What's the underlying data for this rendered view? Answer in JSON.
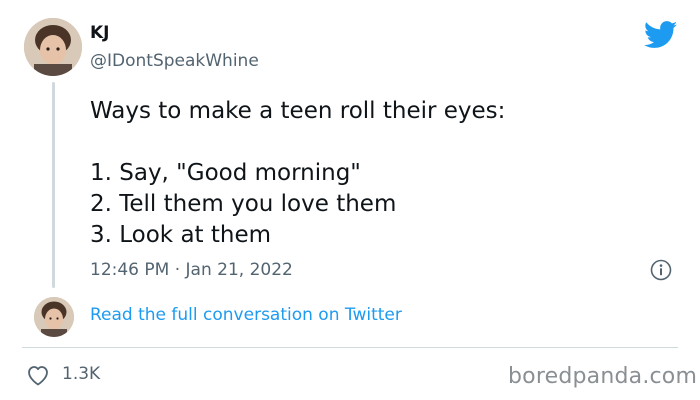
{
  "user": {
    "name": "KJ",
    "handle": "@IDontSpeakWhine"
  },
  "tweet": {
    "lines": [
      "Ways to make a teen roll their eyes:",
      "",
      "1. Say, \"Good morning\"",
      "2. Tell them you love them",
      "3. Look at them"
    ],
    "timestamp": "12:46 PM · Jan 21, 2022"
  },
  "conversation_link": "Read the full conversation on Twitter",
  "likes": {
    "count": "1.3K"
  },
  "watermark": "boredpanda.com",
  "colors": {
    "twitter_blue": "#1d9bf0",
    "secondary_text": "#536471",
    "primary_text": "#0f1419",
    "divider": "#cfd9de"
  },
  "icons": [
    "twitter-bird-icon",
    "info-icon",
    "heart-icon"
  ]
}
